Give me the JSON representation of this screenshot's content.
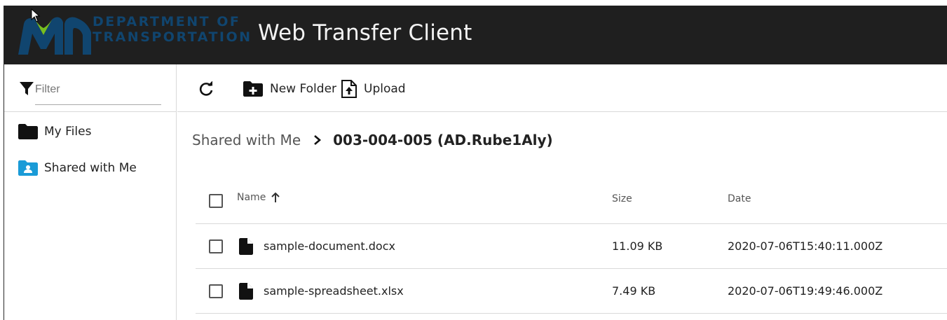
{
  "header": {
    "logo_line1": "DEPARTMENT OF",
    "logo_line2": "TRANSPORTATION",
    "app_title": "Web Transfer Client",
    "background": "#1f1f1f",
    "logo_color": "#10456f"
  },
  "sidebar": {
    "filter_placeholder": "Filter",
    "items": [
      {
        "label": "My Files",
        "icon": "folder-icon"
      },
      {
        "label": "Shared with Me",
        "icon": "shared-folder-icon",
        "icon_color": "#1a9bd7"
      }
    ]
  },
  "toolbar": {
    "refresh_icon": "refresh-icon",
    "new_folder_label": "New Folder",
    "upload_label": "Upload"
  },
  "breadcrumb": {
    "root": "Shared with Me",
    "current": "003-004-005 (AD.Rube1Aly)"
  },
  "table": {
    "columns": {
      "name": "Name",
      "size": "Size",
      "date": "Date"
    },
    "sort": {
      "column": "name",
      "direction": "ascending"
    },
    "rows": [
      {
        "name": "sample-document.docx",
        "size": "11.09 KB",
        "date": "2020-07-06T15:40:11.000Z"
      },
      {
        "name": "sample-spreadsheet.xlsx",
        "size": "7.49 KB",
        "date": "2020-07-06T19:49:46.000Z"
      }
    ]
  }
}
